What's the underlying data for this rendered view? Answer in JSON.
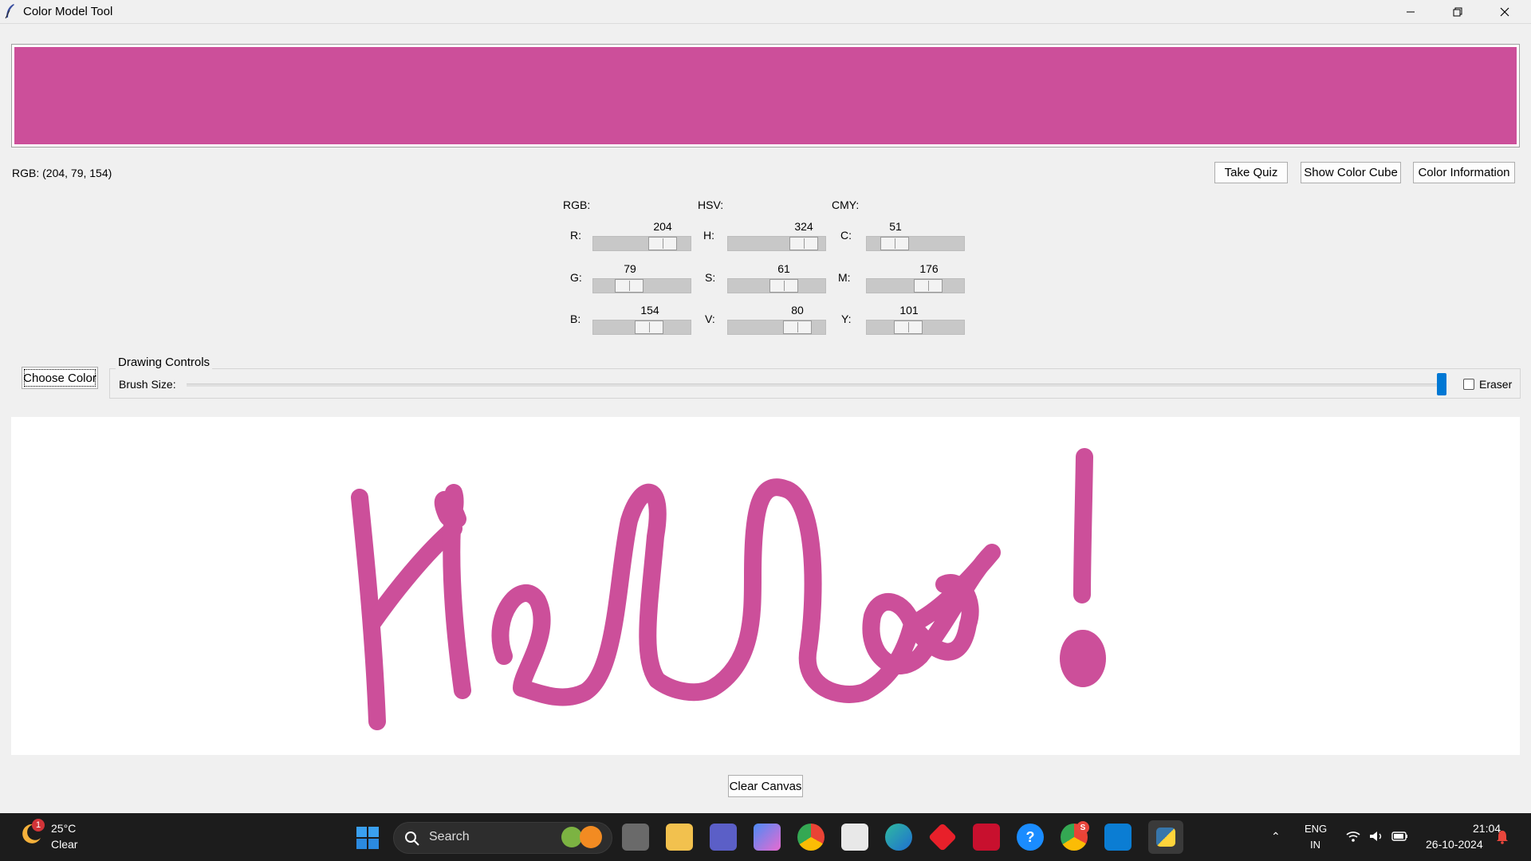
{
  "window": {
    "title": "Color Model Tool",
    "minimize_icon": "minimize-icon",
    "maximize_icon": "restore-icon",
    "close_icon": "close-icon"
  },
  "current_color": "#cc4f9a",
  "rgb_readout": "RGB: (204, 79, 154)",
  "buttons": {
    "quiz": "Take Quiz",
    "cube": "Show Color Cube",
    "info": "Color Information",
    "choose_color": "Choose Color",
    "clear_canvas": "Clear Canvas"
  },
  "models": {
    "rgb": {
      "label": "RGB:",
      "channels": [
        {
          "name": "R:",
          "value": "204",
          "fraction": 0.8
        },
        {
          "name": "G:",
          "value": "79",
          "fraction": 0.31
        },
        {
          "name": "B:",
          "value": "154",
          "fraction": 0.6
        }
      ]
    },
    "hsv": {
      "label": "HSV:",
      "channels": [
        {
          "name": "H:",
          "value": "324",
          "fraction": 0.9
        },
        {
          "name": "S:",
          "value": "61",
          "fraction": 0.61
        },
        {
          "name": "V:",
          "value": "80",
          "fraction": 0.8
        }
      ]
    },
    "cmy": {
      "label": "CMY:",
      "channels": [
        {
          "name": "C:",
          "value": "51",
          "fraction": 0.2
        },
        {
          "name": "M:",
          "value": "176",
          "fraction": 0.69
        },
        {
          "name": "Y:",
          "value": "101",
          "fraction": 0.4
        }
      ]
    }
  },
  "drawing": {
    "title": "Drawing Controls",
    "brush_label": "Brush Size:",
    "brush_fraction": 1.0,
    "eraser_label": "Eraser",
    "eraser_checked": false
  },
  "taskbar": {
    "weather_temp": "25°C",
    "weather_cond": "Clear",
    "weather_badge": "1",
    "search_text": "Search",
    "lang_line1": "ENG",
    "lang_line2": "IN",
    "time": "21:04",
    "date": "26-10-2024",
    "chrome_badge": "S"
  }
}
